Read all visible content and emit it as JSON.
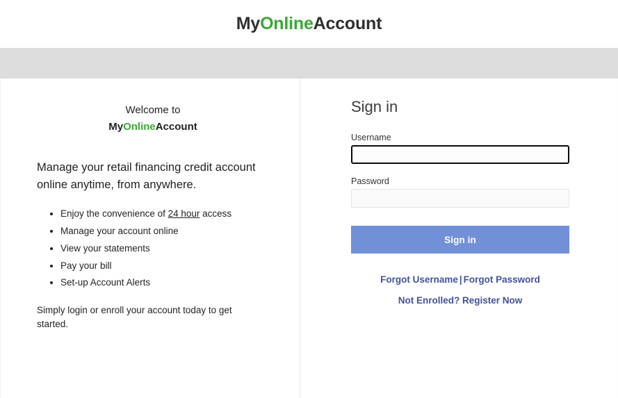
{
  "header": {
    "brand": {
      "part1": "My",
      "part2": "Online",
      "part3": "Account"
    }
  },
  "navband": {
    "label": ""
  },
  "info": {
    "welcome_line": "Welcome to",
    "brand": {
      "part1": "My",
      "part2": "Online",
      "part3": "Account"
    },
    "tagline": "Manage your retail financing credit account online anytime, from anywhere.",
    "benefits": [
      {
        "prefix": "Enjoy the convenience of ",
        "underlined": "24 hour",
        "suffix": " access"
      },
      {
        "prefix": "Manage your account online",
        "underlined": "",
        "suffix": ""
      },
      {
        "prefix": "View your statements",
        "underlined": "",
        "suffix": ""
      },
      {
        "prefix": "Pay your bill",
        "underlined": "",
        "suffix": ""
      },
      {
        "prefix": "Set-up Account Alerts",
        "underlined": "",
        "suffix": ""
      }
    ],
    "closing": "Simply login or enroll your account today to get started."
  },
  "signin": {
    "title": "Sign in",
    "username": {
      "label": "Username",
      "value": "",
      "placeholder": ""
    },
    "password": {
      "label": "Password",
      "value": "",
      "placeholder": ""
    },
    "button_label": "Sign in",
    "links": {
      "forgot_username": "Forgot Username",
      "separator": "|",
      "forgot_password": "Forgot Password",
      "register": "Not Enrolled? Register Now"
    }
  },
  "colors": {
    "brand_green": "#3aa935",
    "brand_dark": "#2f2f2f",
    "button_blue": "#7190d8",
    "link_blue": "#41519f",
    "nav_band_gray": "#dcdcdc"
  }
}
